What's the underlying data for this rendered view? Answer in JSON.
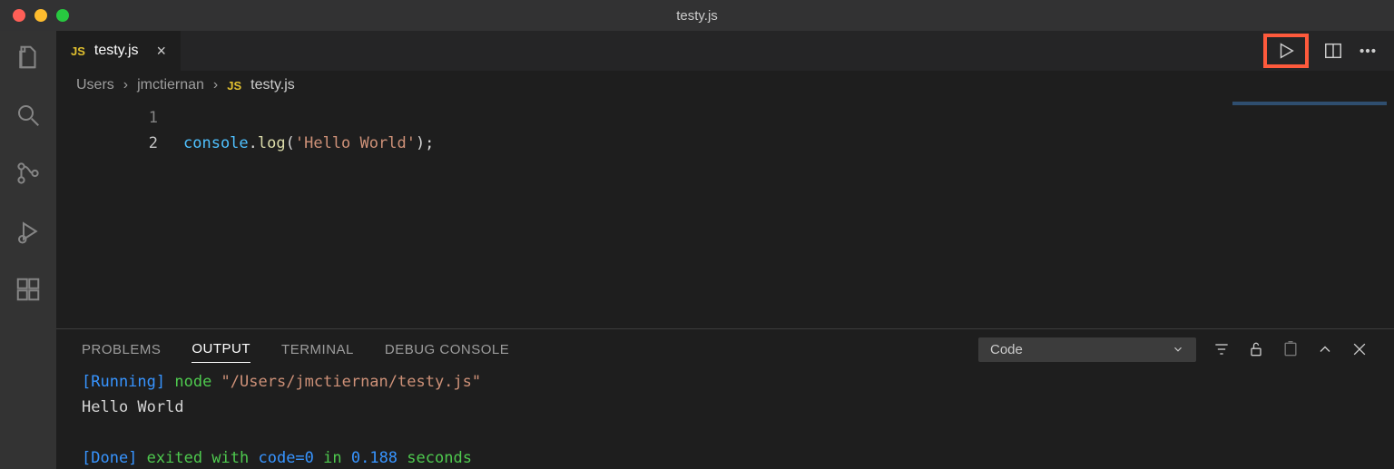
{
  "window": {
    "title": "testy.js"
  },
  "tab": {
    "badge": "JS",
    "filename": "testy.js"
  },
  "breadcrumb": {
    "seg1": "Users",
    "seg2": "jmctiernan",
    "badge": "JS",
    "seg3": "testy.js"
  },
  "editor": {
    "lines": [
      {
        "num": "1",
        "code": ""
      },
      {
        "num": "2"
      }
    ],
    "line2": {
      "obj": "console",
      "dot": ".",
      "func": "log",
      "open": "(",
      "str": "'Hello World'",
      "close": ");"
    }
  },
  "panel": {
    "tabs": {
      "problems": "PROBLEMS",
      "output": "OUTPUT",
      "terminal": "TERMINAL",
      "debug": "DEBUG CONSOLE"
    },
    "dropdown": "Code",
    "output": {
      "l1a": "[Running]",
      "l1b": " node ",
      "l1c": "\"/Users/jmctiernan/testy.js\"",
      "l2": "Hello World",
      "l4a": "[Done]",
      "l4b": " exited with ",
      "l4c": "code=0",
      "l4d": " in ",
      "l4e": "0.188",
      "l4f": " seconds"
    }
  }
}
